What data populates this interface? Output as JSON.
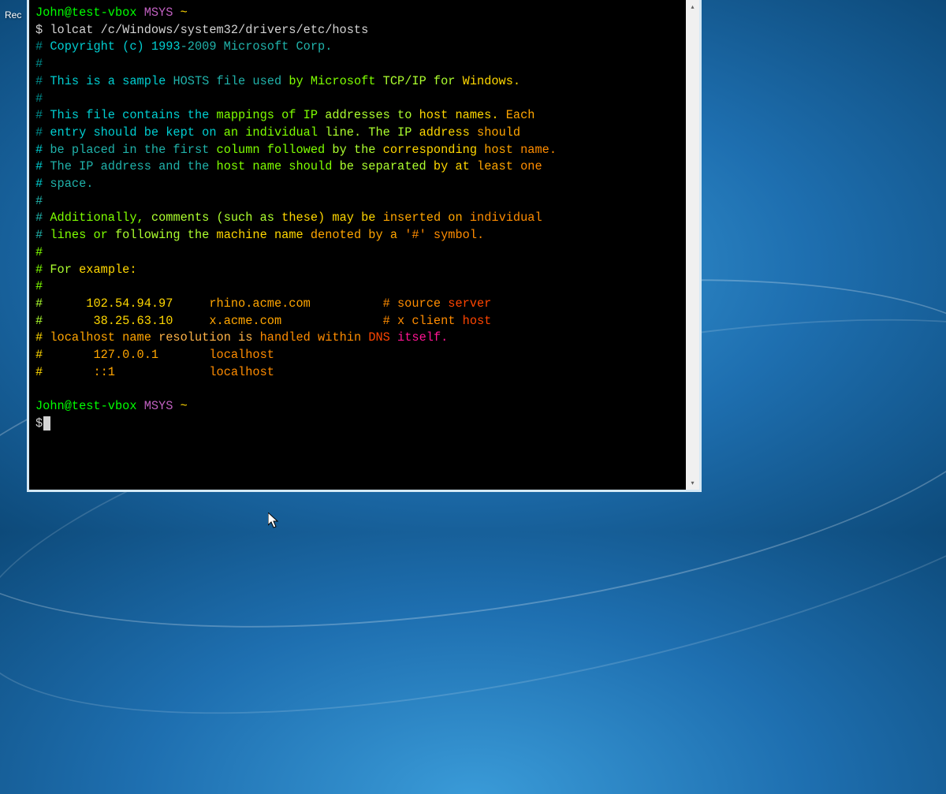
{
  "desktop": {
    "icon_label": "Rec"
  },
  "prompt": {
    "user": "John@test-vbox",
    "env": "MSYS",
    "path": "~",
    "symbol": "$"
  },
  "command": "lolcat /c/Windows/system32/drivers/etc/hosts",
  "output": {
    "l1": "# Copyright (c) 1993-2009 Microsoft Corp.",
    "l2": "#",
    "l3": "# This is a sample HOSTS file used by Microsoft TCP/IP for Windows.",
    "l4": "#",
    "l5": "# This file contains the mappings of IP addresses to host names. Each",
    "l6": "# entry should be kept on an individual line. The IP address should",
    "l7": "# be placed in the first column followed by the corresponding host name.",
    "l8": "# The IP address and the host name should be separated by at least one",
    "l9": "# space.",
    "l10": "#",
    "l11": "# Additionally, comments (such as these) may be inserted on individual",
    "l12": "# lines or following the machine name denoted by a '#' symbol.",
    "l13": "#",
    "l14": "# For example:",
    "l15": "#",
    "l16": "#      102.54.94.97     rhino.acme.com          # source server",
    "l17": "#       38.25.63.10     x.acme.com              # x client host",
    "l18": "",
    "l19": "# localhost name resolution is handled within DNS itself.",
    "l20": "#       127.0.0.1       localhost",
    "l21": "#       ::1             localhost"
  }
}
